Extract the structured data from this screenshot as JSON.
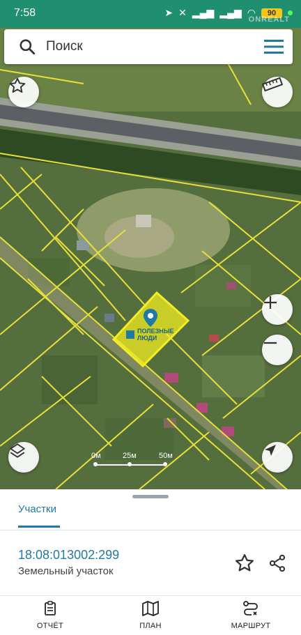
{
  "status_bar": {
    "time": "7:58",
    "battery": "90",
    "watermark": "ONREALT"
  },
  "search": {
    "placeholder": "Поиск"
  },
  "map": {
    "parcel_label_line1": "ПОЛЕЗНЫЕ",
    "parcel_label_line2": "ЛЮДИ",
    "scale": {
      "labels": [
        "0м",
        "25м",
        "50м"
      ]
    },
    "colors": {
      "parcel_border": "#e8e03a",
      "selected_fill": "#f2ee21",
      "road": "#5c6065",
      "pin": "#1e7aa0"
    }
  },
  "sheet": {
    "tab_label": "Участки",
    "cadastral_number": "18:08:013002:299",
    "parcel_type": "Земельный участок"
  },
  "bottom_nav": {
    "items": [
      {
        "label": "ОТЧЁТ",
        "icon": "report-icon"
      },
      {
        "label": "ПЛАН",
        "icon": "map-plan-icon"
      },
      {
        "label": "МАРШРУТ",
        "icon": "route-icon"
      }
    ]
  }
}
